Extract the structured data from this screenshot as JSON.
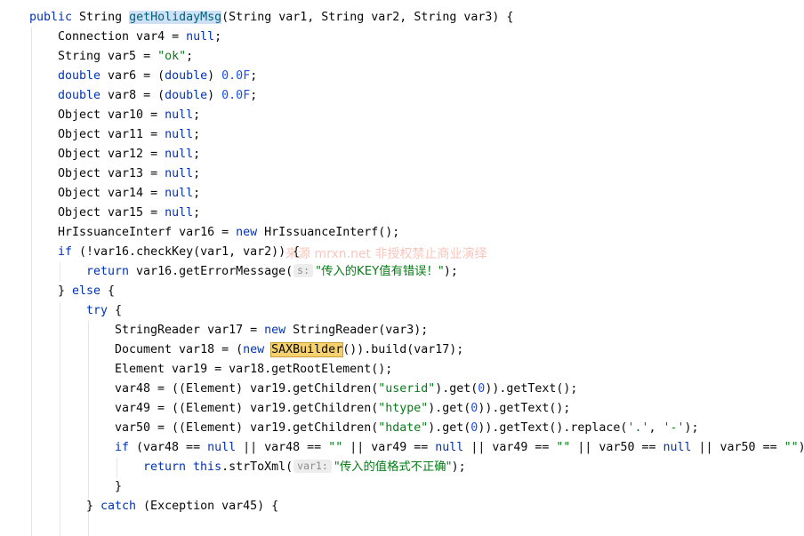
{
  "editor": {
    "lines": [
      {
        "indent": 1,
        "tokens": [
          {
            "t": "public ",
            "c": "kw"
          },
          {
            "t": "String "
          },
          {
            "t": "getHolidayMsg",
            "c": "hl-sel"
          },
          {
            "t": "(String var1, String var2, String var3) {"
          }
        ]
      },
      {
        "indent": 2,
        "tokens": [
          {
            "t": "Connection var4 = "
          },
          {
            "t": "null",
            "c": "kw"
          },
          {
            "t": ";"
          }
        ]
      },
      {
        "indent": 2,
        "tokens": [
          {
            "t": "String var5 = "
          },
          {
            "t": "\"ok\"",
            "c": "str"
          },
          {
            "t": ";"
          }
        ]
      },
      {
        "indent": 2,
        "tokens": [
          {
            "t": "double",
            "c": "kw"
          },
          {
            "t": " var6 = ("
          },
          {
            "t": "double",
            "c": "kw"
          },
          {
            "t": ") "
          },
          {
            "t": "0.0F",
            "c": "num"
          },
          {
            "t": ";"
          }
        ]
      },
      {
        "indent": 2,
        "tokens": [
          {
            "t": "double",
            "c": "kw"
          },
          {
            "t": " var8 = ("
          },
          {
            "t": "double",
            "c": "kw"
          },
          {
            "t": ") "
          },
          {
            "t": "0.0F",
            "c": "num"
          },
          {
            "t": ";"
          }
        ]
      },
      {
        "indent": 2,
        "tokens": [
          {
            "t": "Object var10 = "
          },
          {
            "t": "null",
            "c": "kw"
          },
          {
            "t": ";"
          }
        ]
      },
      {
        "indent": 2,
        "tokens": [
          {
            "t": "Object var11 = "
          },
          {
            "t": "null",
            "c": "kw"
          },
          {
            "t": ";"
          }
        ]
      },
      {
        "indent": 2,
        "tokens": [
          {
            "t": "Object var12 = "
          },
          {
            "t": "null",
            "c": "kw"
          },
          {
            "t": ";"
          }
        ]
      },
      {
        "indent": 2,
        "tokens": [
          {
            "t": "Object var13 = "
          },
          {
            "t": "null",
            "c": "kw"
          },
          {
            "t": ";"
          }
        ]
      },
      {
        "indent": 2,
        "tokens": [
          {
            "t": "Object var14 = "
          },
          {
            "t": "null",
            "c": "kw"
          },
          {
            "t": ";"
          }
        ]
      },
      {
        "indent": 2,
        "tokens": [
          {
            "t": "Object var15 = "
          },
          {
            "t": "null",
            "c": "kw"
          },
          {
            "t": ";"
          }
        ]
      },
      {
        "indent": 2,
        "tokens": [
          {
            "t": "HrIssuanceInterf var16 = "
          },
          {
            "t": "new ",
            "c": "kw"
          },
          {
            "t": "HrIssuanceInterf();"
          }
        ]
      },
      {
        "indent": 2,
        "tokens": [
          {
            "t": "if",
            "c": "kw"
          },
          {
            "t": " (!var16.checkKey(var1, var2)) {"
          }
        ]
      },
      {
        "indent": 3,
        "tokens": [
          {
            "t": "return ",
            "c": "kw"
          },
          {
            "t": "var16.getErrorMessage("
          },
          {
            "t": "s:",
            "c": "hint"
          },
          {
            "t": "\"传入的KEY值有错误！\"",
            "c": "str cn"
          },
          {
            "t": ");"
          }
        ]
      },
      {
        "indent": 2,
        "tokens": [
          {
            "t": "} "
          },
          {
            "t": "else",
            "c": "kw"
          },
          {
            "t": " {"
          }
        ]
      },
      {
        "indent": 3,
        "tokens": [
          {
            "t": "try",
            "c": "kw"
          },
          {
            "t": " {"
          }
        ]
      },
      {
        "indent": 4,
        "tokens": [
          {
            "t": "StringReader var17 = "
          },
          {
            "t": "new ",
            "c": "kw"
          },
          {
            "t": "StringReader(var3);"
          }
        ]
      },
      {
        "indent": 4,
        "tokens": [
          {
            "t": "Document var18 = ("
          },
          {
            "t": "new ",
            "c": "kw"
          },
          {
            "t": "SAXBuilder",
            "c": "hl-box"
          },
          {
            "t": "()).build(var17);"
          }
        ]
      },
      {
        "indent": 4,
        "tokens": [
          {
            "t": "Element var19 = var18.getRootElement();"
          }
        ]
      },
      {
        "indent": 4,
        "tokens": [
          {
            "t": "var48 = ((Element) var19.getChildren("
          },
          {
            "t": "\"userid\"",
            "c": "str"
          },
          {
            "t": ").get("
          },
          {
            "t": "0",
            "c": "num"
          },
          {
            "t": ")).getText();"
          }
        ]
      },
      {
        "indent": 4,
        "tokens": [
          {
            "t": "var49 = ((Element) var19.getChildren("
          },
          {
            "t": "\"htype\"",
            "c": "str"
          },
          {
            "t": ").get("
          },
          {
            "t": "0",
            "c": "num"
          },
          {
            "t": ")).getText();"
          }
        ]
      },
      {
        "indent": 4,
        "tokens": [
          {
            "t": "var50 = ((Element) var19.getChildren("
          },
          {
            "t": "\"hdate\"",
            "c": "str"
          },
          {
            "t": ").get("
          },
          {
            "t": "0",
            "c": "num"
          },
          {
            "t": ")).getText().replace("
          },
          {
            "t": "'.'",
            "c": "str"
          },
          {
            "t": ", "
          },
          {
            "t": "'-'",
            "c": "str"
          },
          {
            "t": ");"
          }
        ]
      },
      {
        "indent": 4,
        "tokens": [
          {
            "t": "if",
            "c": "kw"
          },
          {
            "t": " (var48 == "
          },
          {
            "t": "null",
            "c": "kw"
          },
          {
            "t": " || var48 == "
          },
          {
            "t": "\"\"",
            "c": "str"
          },
          {
            "t": " || var49 == "
          },
          {
            "t": "null",
            "c": "kw"
          },
          {
            "t": " || var49 == "
          },
          {
            "t": "\"\"",
            "c": "str"
          },
          {
            "t": " || var50 == "
          },
          {
            "t": "null",
            "c": "kw"
          },
          {
            "t": " || var50 == "
          },
          {
            "t": "\"\"",
            "c": "str"
          },
          {
            "t": ")"
          }
        ]
      },
      {
        "indent": 5,
        "tokens": [
          {
            "t": "return ",
            "c": "kw"
          },
          {
            "t": "this",
            "c": "kw"
          },
          {
            "t": ".strToXml("
          },
          {
            "t": "var1:",
            "c": "hint"
          },
          {
            "t": "\"传入的值格式不正确\"",
            "c": "str cn"
          },
          {
            "t": ");"
          }
        ]
      },
      {
        "indent": 4,
        "tokens": [
          {
            "t": "}"
          }
        ]
      },
      {
        "indent": 3,
        "tokens": [
          {
            "t": "} "
          },
          {
            "t": "catch",
            "c": "kw"
          },
          {
            "t": " (Exception var45) {"
          }
        ]
      }
    ]
  },
  "watermark": "来源 mrxn.net 非授权禁止商业演绎"
}
